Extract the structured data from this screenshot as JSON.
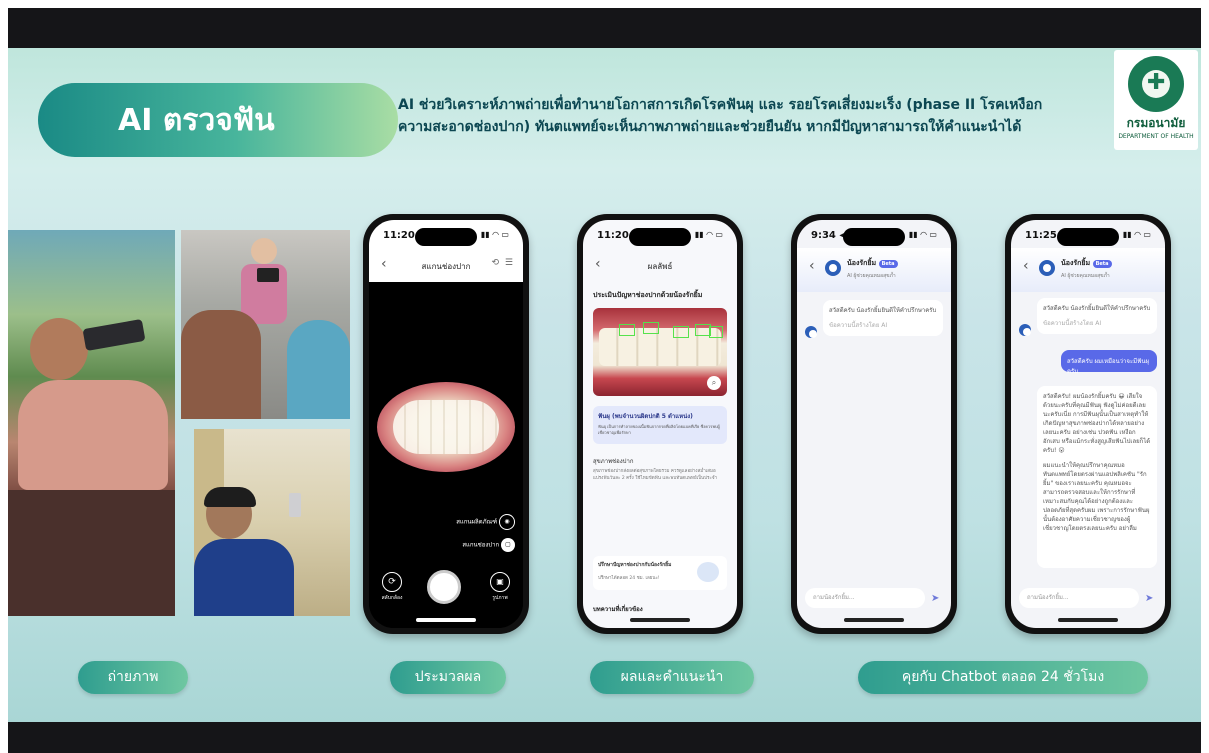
{
  "title": "AI ตรวจฟัน",
  "description_line1": "AI ช่วยวิเคราะห์ภาพถ่ายเพื่อทำนายโอกาสการเกิดโรคฟันผุ และ รอยโรคเสี่ยงมะเร็ง (phase II โรคเหงือก",
  "description_line2": "ความสะอาดช่องปาก) ทันตแพทย์จะเห็นภาพภาพถ่ายและช่วยยืนยัน หากมีปัญหาสามารถให้คำแนะนำได้",
  "logo": {
    "name_th": "กรมอนามัย",
    "name_en": "DEPARTMENT OF HEALTH"
  },
  "steps": [
    "ถ่ายภาพ",
    "ประมวลผล",
    "ผลและคำแนะนำ",
    "คุยกับ Chatbot ตลอด 24 ชั่วโมง"
  ],
  "phone1": {
    "time": "11:20 ◂",
    "title": "สแกนช่องปาก",
    "btn_sample": "สแกนผลิตภัณฑ์",
    "btn_scan": "สแกนช่องปาก",
    "switch_label": "สลับกล้อง",
    "gallery_label": "รูปภาพ"
  },
  "phone2": {
    "time": "11:20 ◂",
    "title": "ผลลัพธ์",
    "heading": "ประเมินปัญหาช่องปากด้วยน้องรักยิ้ม",
    "finding_title": "ฟันผุ (พบจำนวนผิดปกติ 5 ตำแหน่ง)",
    "finding_text": "ฟันผุ เป็นการทำลายของเนื้อฟันจากกรดที่ผลิตโดยแบคทีเรีย ซึ่งควรพบผู้เชี่ยวชาญเพื่อรักษา",
    "section": "สุขภาพช่องปาก",
    "section_text": "สุขภาพช่องปากส่งผลต่อสุขภาพโดยรวม ควรดูแลอย่างสม่ำเสมอ แปรงฟันวันละ 2 ครั้ง ใช้ไหมขัดฟัน และพบทันตแพทย์เป็นประจำ",
    "consult_title": "ปรึกษาปัญหาช่องปากกับน้องรักยิ้ม",
    "consult_text": "ปรึกษาได้ตลอด 24 ชม. เลยนะ!",
    "more": "บทความที่เกี่ยวข้อง"
  },
  "phone3": {
    "time": "9:34 ◂",
    "bot_name": "น้องรักยิ้ม",
    "badge": "Beta",
    "bot_sub": "AI ผู้ช่วยคุณหมอสุขภ้ำ",
    "greet": "สวัสดีครับ น้องรักยิ้มยินดีให้คำปรึกษาครับ",
    "greet_note": "ข้อความนี้สร้างโดย AI",
    "input_placeholder": "ถามน้องรักยิ้ม..."
  },
  "phone4": {
    "time": "11:25 ◂",
    "bot_name": "น้องรักยิ้ม",
    "badge": "Beta",
    "bot_sub": "AI ผู้ช่วยคุณหมอสุขภ้ำ",
    "greet": "สวัสดีครับ น้องรักยิ้มยินดีให้คำปรึกษาครับ",
    "greet_note": "ข้อความนี้สร้างโดย AI",
    "user_msg": "สวัสดีครับ ผมเหมือนว่าจะมีฟันผุครับ",
    "reply1": "สวัสดีครับ! ผมน้องรักยิ้มครับ 😀 เสียใจด้วยนะครับที่คุณมีฟันผุ ฟังดูไม่ค่อยดีเลยนะครับเนี่ย การมีฟันผุนั้นเป็นสาเหตุทำให้เกิดปัญหาสุขภาพช่องปากได้หลายอย่างเลยนะครับ อย่างเช่น ปวดฟัน เหงือกอักเสบ หรือแม้กระทั่งสูญเสียฟันไปเลยก็ได้ครับ! 😮",
    "reply2": "ผมแนะนำให้คุณปรึกษาคุณหมอทันตแพทย์โดยตรงผ่านแอปพลิเคชัน \"รักยิ้ม\" ของเราเลยนะครับ คุณหมอจะสามารถตรวจสอบและให้การรักษาที่เหมาะสมกับคุณได้อย่างถูกต้องและปลอดภัยที่สุดครับผม เพราะการรักษาฟันผุนั้นต้องอาศัยความเชี่ยวชาญของผู้เชี่ยวชาญโดยตรงเลยนะครับ อย่าลืม",
    "input_placeholder": "ถามน้องรักยิ้ม..."
  }
}
